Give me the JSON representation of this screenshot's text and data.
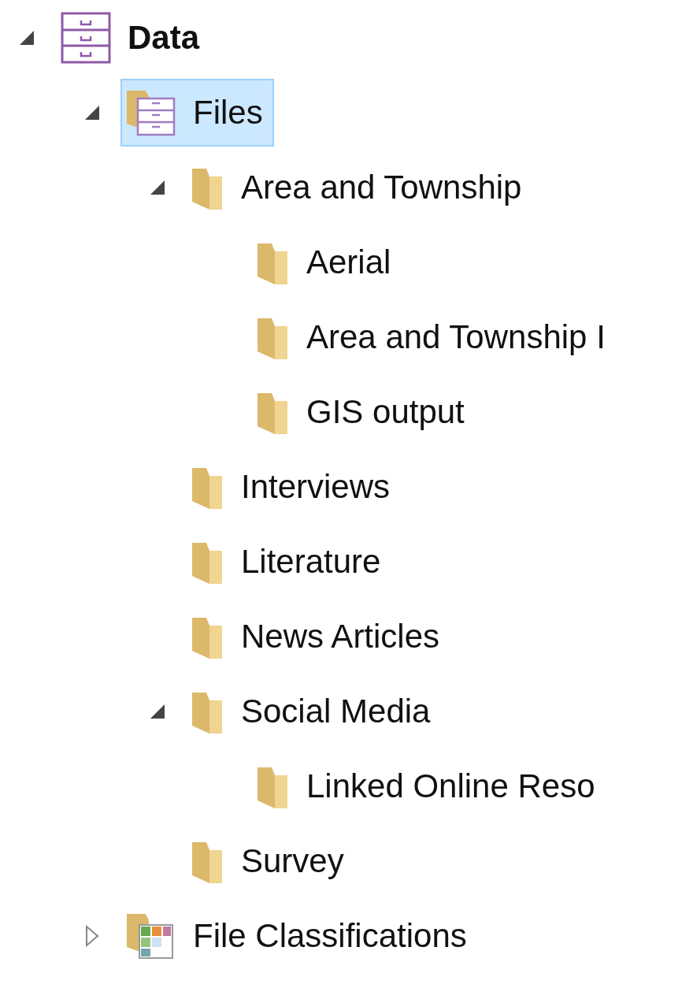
{
  "tree": [
    {
      "label": "Data",
      "kind": "cabinet",
      "expanded": true,
      "selected": false,
      "children": [
        {
          "label": "Files",
          "kind": "file-cabinet",
          "expanded": true,
          "selected": true,
          "children": [
            {
              "label": "Area and Township",
              "kind": "folder",
              "expanded": true,
              "selected": false,
              "children": [
                {
                  "label": "Aerial",
                  "kind": "folder",
                  "selected": false
                },
                {
                  "label": "Area and Township I",
                  "kind": "folder",
                  "selected": false
                },
                {
                  "label": "GIS output",
                  "kind": "folder",
                  "selected": false
                }
              ]
            },
            {
              "label": "Interviews",
              "kind": "folder",
              "selected": false
            },
            {
              "label": "Literature",
              "kind": "folder",
              "selected": false
            },
            {
              "label": "News Articles",
              "kind": "folder",
              "selected": false
            },
            {
              "label": "Social Media",
              "kind": "folder",
              "expanded": true,
              "selected": false,
              "children": [
                {
                  "label": "Linked Online Reso",
                  "kind": "folder",
                  "selected": false
                }
              ]
            },
            {
              "label": "Survey",
              "kind": "folder",
              "selected": false
            }
          ]
        },
        {
          "label": "File Classifications",
          "kind": "classification",
          "expanded": false,
          "selected": false
        }
      ]
    }
  ]
}
